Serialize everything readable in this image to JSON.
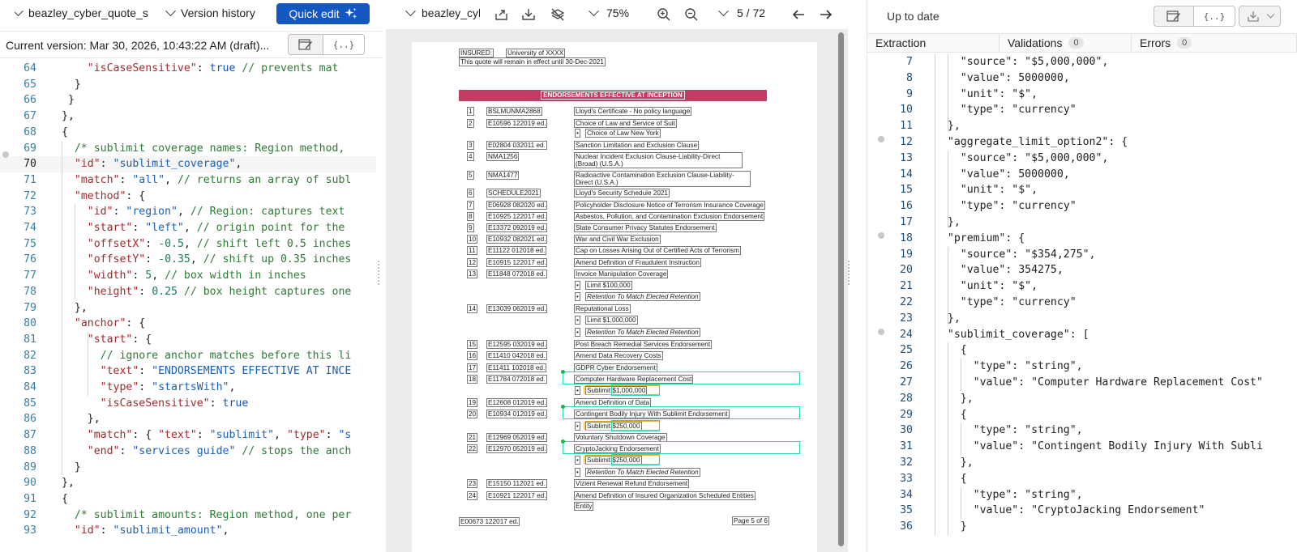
{
  "left": {
    "file_name": "beazley_cyber_quote_s",
    "version_history_label": "Version history",
    "quick_edit_label": "Quick edit",
    "current_version_label": "Current version:",
    "current_version_value": "Mar 30, 2026, 10:43:22 AM (draft)...",
    "braces_label": "{..}",
    "code_lines": [
      {
        "n": "64",
        "html": "    <span class=\"key\">\"isCaseSensitive\"</span>: <span class=\"kw\">true</span> <span class=\"cm\">// prevents mat</span>"
      },
      {
        "n": "65",
        "html": "  }"
      },
      {
        "n": "66",
        "html": " }"
      },
      {
        "n": "67",
        "html": "},"
      },
      {
        "n": "68",
        "html": "{"
      },
      {
        "n": "69",
        "html": "  <span class=\"cm\">/* sublimit coverage names: Region method,</span>"
      },
      {
        "n": "70",
        "html": "  <span class=\"key\">\"id\"</span>: <span class=\"str\">\"sublimit_coverage\"</span>,"
      },
      {
        "n": "71",
        "html": "  <span class=\"key\">\"match\"</span>: <span class=\"str\">\"all\"</span>, <span class=\"cm\">// returns an array of subl</span>"
      },
      {
        "n": "72",
        "html": "  <span class=\"key\">\"method\"</span>: {"
      },
      {
        "n": "73",
        "html": "    <span class=\"key\">\"id\"</span>: <span class=\"str\">\"region\"</span>, <span class=\"cm\">// Region: captures text</span>"
      },
      {
        "n": "74",
        "html": "    <span class=\"key\">\"start\"</span>: <span class=\"str\">\"left\"</span>, <span class=\"cm\">// origin point for the</span>"
      },
      {
        "n": "75",
        "html": "    <span class=\"key\">\"offsetX\"</span>: <span class=\"num\">-0.5</span>, <span class=\"cm\">// shift left 0.5 inches</span>"
      },
      {
        "n": "76",
        "html": "    <span class=\"key\">\"offsetY\"</span>: <span class=\"num\">-0.35</span>, <span class=\"cm\">// shift up 0.35 inches</span>"
      },
      {
        "n": "77",
        "html": "    <span class=\"key\">\"width\"</span>: <span class=\"num\">5</span>, <span class=\"cm\">// box width in inches</span>"
      },
      {
        "n": "78",
        "html": "    <span class=\"key\">\"height\"</span>: <span class=\"num\">0.25</span> <span class=\"cm\">// box height captures one</span>"
      },
      {
        "n": "79",
        "html": "  },"
      },
      {
        "n": "80",
        "html": "  <span class=\"key\">\"anchor\"</span>: {"
      },
      {
        "n": "81",
        "html": "    <span class=\"key\">\"start\"</span>: {"
      },
      {
        "n": "82",
        "html": "      <span class=\"cm\">// ignore anchor matches before this li</span>"
      },
      {
        "n": "83",
        "html": "      <span class=\"key\">\"text\"</span>: <span class=\"str\">\"ENDORSEMENTS EFFECTIVE AT INCE</span>"
      },
      {
        "n": "84",
        "html": "      <span class=\"key\">\"type\"</span>: <span class=\"str\">\"startsWith\"</span>,"
      },
      {
        "n": "85",
        "html": "      <span class=\"key\">\"isCaseSensitive\"</span>: <span class=\"kw\">true</span>"
      },
      {
        "n": "86",
        "html": "    },"
      },
      {
        "n": "87",
        "html": "    <span class=\"key\">\"match\"</span>: { <span class=\"key\">\"text\"</span>: <span class=\"str\">\"sublimit\"</span>, <span class=\"key\">\"type\"</span>: <span class=\"str\">\"s</span>"
      },
      {
        "n": "88",
        "html": "    <span class=\"key\">\"end\"</span>: <span class=\"str\">\"services guide\"</span> <span class=\"cm\">// stops the anch</span>"
      },
      {
        "n": "89",
        "html": "  }"
      },
      {
        "n": "90",
        "html": "},"
      },
      {
        "n": "91",
        "html": "{"
      },
      {
        "n": "92",
        "html": "  <span class=\"cm\">/* sublimit amounts: Region method, one per</span>"
      },
      {
        "n": "93",
        "html": "  <span class=\"key\">\"id\"</span>: <span class=\"str\">\"sublimit_amount\"</span>,"
      }
    ]
  },
  "middle": {
    "doc_name": "beazley_cybe",
    "zoom": "75%",
    "page_indicator": "5 / 72",
    "insured_label": "INSURED:",
    "insured_value": "University of XXXX",
    "effect_text": "This quote will remain in effect until 30-Dec-2021",
    "banner": "ENDORSEMENTS EFFECTIVE AT INCEPTION",
    "rows": [
      {
        "no": "1",
        "code": "BSLMUNMA2868",
        "title": "Lloyd's Certificate - No policy language"
      },
      {
        "no": "2",
        "code": "E10596 122019 ed.",
        "title": "Choice of Law and Service of Suit"
      },
      {
        "no": "",
        "code": "",
        "title": "Choice of Law New York",
        "sub": true
      },
      {
        "no": "3",
        "code": "E02804 032011 ed.",
        "title": "Sanction Limitation and Exclusion Clause"
      },
      {
        "no": "4",
        "code": "NMA1256",
        "title": "Nuclear Incident Exclusion Clause-Liability-Direct (Broad) (U.S.A.)"
      },
      {
        "no": "5",
        "code": "NMA1477",
        "title": "Radioactive Contamination Exclusion Clause-Liability-Direct (U.S.A.)"
      },
      {
        "no": "6",
        "code": "SCHEDULE2021",
        "title": "Lloyd's Security Schedule 2021"
      },
      {
        "no": "7",
        "code": "E06928 082020 ed.",
        "title": "Policyholder Disclosure Notice of Terrorism Insurance Coverage"
      },
      {
        "no": "8",
        "code": "E10925 122017 ed.",
        "title": "Asbestos, Pollution, and Contamination Exclusion Endorsement"
      },
      {
        "no": "9",
        "code": "E13372 092019 ed.",
        "title": "State Consumer Privacy Statutes Endorsement"
      },
      {
        "no": "10",
        "code": "E10932 082021 ed.",
        "title": "War and Civil War Exclusion"
      },
      {
        "no": "11",
        "code": "E11122 012018 ed.",
        "title": "Cap on Losses Arising Out of Certified Acts of Terrorism"
      },
      {
        "no": "12",
        "code": "E10915 122017 ed.",
        "title": "Amend Definition of Fraudulent Instruction"
      },
      {
        "no": "13",
        "code": "E11848 072018 ed.",
        "title": "Invoice Manipulation Coverage"
      },
      {
        "no": "",
        "code": "",
        "title": "Limit $100,000",
        "sub": true
      },
      {
        "no": "",
        "code": "",
        "title": "Retention To Match Elected Retention",
        "sub": true
      },
      {
        "no": "14",
        "code": "E13039 062019 ed.",
        "title": "Reputational Loss"
      },
      {
        "no": "",
        "code": "",
        "title": "Limit $1,000,000",
        "sub": true
      },
      {
        "no": "",
        "code": "",
        "title": "Retention To Match Elected Retention",
        "sub": true
      },
      {
        "no": "15",
        "code": "E12595 032019 ed.",
        "title": "Post Breach Remedial Services Endorsement"
      },
      {
        "no": "16",
        "code": "E11410 042018 ed.",
        "title": "Amend Data Recovery Costs"
      },
      {
        "no": "17",
        "code": "E11411 102018 ed.",
        "title": "GDPR Cyber Endorsement"
      },
      {
        "no": "18",
        "code": "E11784 072018 ed.",
        "title": "Computer Hardware Replacement Cost"
      },
      {
        "no": "",
        "code": "",
        "title": "Sublimit $1,000,000",
        "sub": true
      },
      {
        "no": "19",
        "code": "E12608 012019 ed.",
        "title": "Amend Definition of Data"
      },
      {
        "no": "20",
        "code": "E10934 012019 ed.",
        "title": "Contingent Bodily Injury With Sublimit Endorsement"
      },
      {
        "no": "",
        "code": "",
        "title": "Sublimit $250,000",
        "sub": true
      },
      {
        "no": "21",
        "code": "E12969 052019 ed.",
        "title": "Voluntary Shutdown Coverage"
      },
      {
        "no": "22",
        "code": "E12970 052019 ed.",
        "title": "CryptoJacking Endorsement"
      },
      {
        "no": "",
        "code": "",
        "title": "Sublimit $250,000",
        "sub": true
      },
      {
        "no": "",
        "code": "",
        "title": "Retention To Match Elected Retention",
        "sub": true
      },
      {
        "no": "23",
        "code": "E15150 112021 ed.",
        "title": "Vizient Renewal Refund Endorsement"
      },
      {
        "no": "24",
        "code": "E10921 122017 ed.",
        "title": "Amend Definition of Insured Organization Scheduled Entities"
      },
      {
        "no": "",
        "code": "",
        "title": "Entity",
        "cont": true
      }
    ],
    "footer_left": "E00673 122017 ed.",
    "footer_right": "Page 5 of 6"
  },
  "right": {
    "status": "Up to date",
    "tabs": [
      {
        "label": "Extraction",
        "count": ""
      },
      {
        "label": "Validations",
        "count": "0"
      },
      {
        "label": "Errors",
        "count": "0"
      }
    ],
    "code_lines": [
      {
        "n": "7",
        "text": "    \"source\": \"$5,000,000\","
      },
      {
        "n": "8",
        "text": "    \"value\": 5000000,"
      },
      {
        "n": "9",
        "text": "    \"unit\": \"$\","
      },
      {
        "n": "10",
        "text": "    \"type\": \"currency\""
      },
      {
        "n": "11",
        "text": "  },"
      },
      {
        "n": "12",
        "text": "  \"aggregate_limit_option2\": {"
      },
      {
        "n": "13",
        "text": "    \"source\": \"$5,000,000\","
      },
      {
        "n": "14",
        "text": "    \"value\": 5000000,"
      },
      {
        "n": "15",
        "text": "    \"unit\": \"$\","
      },
      {
        "n": "16",
        "text": "    \"type\": \"currency\""
      },
      {
        "n": "17",
        "text": "  },"
      },
      {
        "n": "18",
        "text": "  \"premium\": {"
      },
      {
        "n": "19",
        "text": "    \"source\": \"$354,275\","
      },
      {
        "n": "20",
        "text": "    \"value\": 354275,"
      },
      {
        "n": "21",
        "text": "    \"unit\": \"$\","
      },
      {
        "n": "22",
        "text": "    \"type\": \"currency\""
      },
      {
        "n": "23",
        "text": "  },"
      },
      {
        "n": "24",
        "text": "  \"sublimit_coverage\": ["
      },
      {
        "n": "25",
        "text": "    {"
      },
      {
        "n": "26",
        "text": "      \"type\": \"string\","
      },
      {
        "n": "27",
        "text": "      \"value\": \"Computer Hardware Replacement Cost\""
      },
      {
        "n": "28",
        "text": "    },"
      },
      {
        "n": "29",
        "text": "    {"
      },
      {
        "n": "30",
        "text": "      \"type\": \"string\","
      },
      {
        "n": "31",
        "text": "      \"value\": \"Contingent Bodily Injury With Subli"
      },
      {
        "n": "32",
        "text": "    },"
      },
      {
        "n": "33",
        "text": "    {"
      },
      {
        "n": "34",
        "text": "      \"type\": \"string\","
      },
      {
        "n": "35",
        "text": "      \"value\": \"CryptoJacking Endorsement\""
      },
      {
        "n": "36",
        "text": "    }"
      }
    ]
  }
}
